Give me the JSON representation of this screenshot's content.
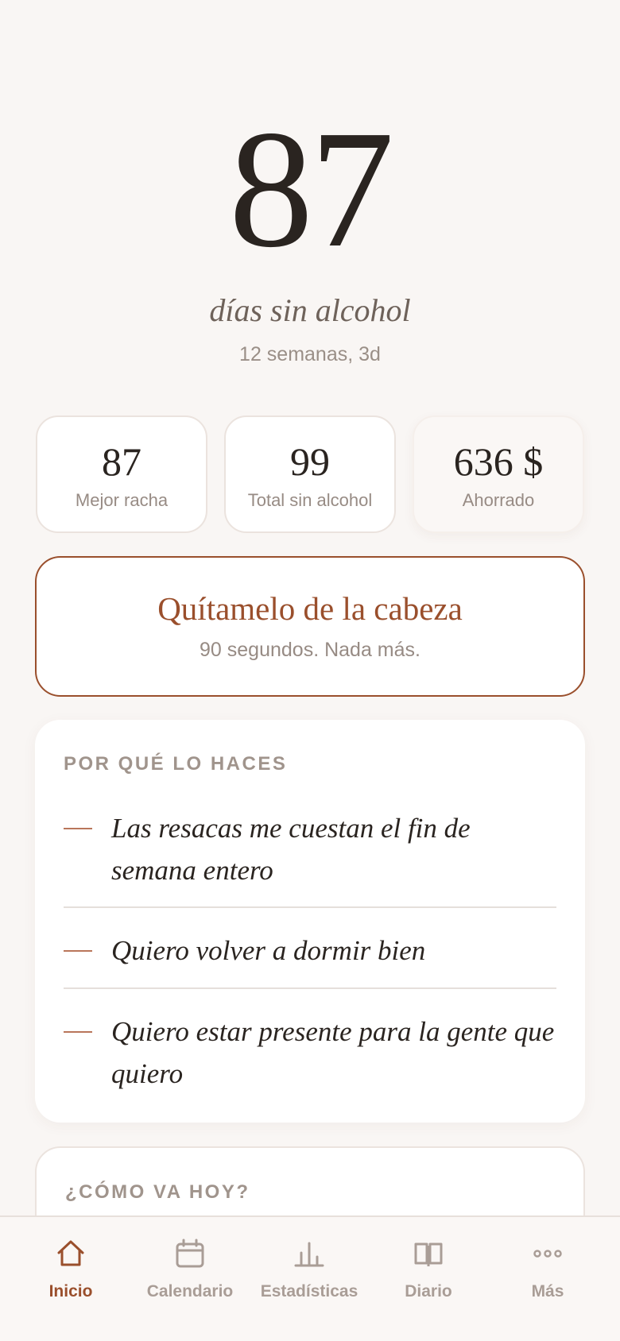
{
  "hero": {
    "count": "87",
    "label": "días sin alcohol",
    "sublabel": "12 semanas, 3d"
  },
  "stats": [
    {
      "value": "87",
      "label": "Mejor racha"
    },
    {
      "value": "99",
      "label": "Total sin alcohol"
    },
    {
      "value": "636 $",
      "label": "Ahorrado"
    }
  ],
  "clear_card": {
    "title": "Quítamelo de la cabeza",
    "subtitle": "90 segundos. Nada más."
  },
  "reasons": {
    "title": "POR QUÉ LO HACES",
    "items": [
      "Las resacas me cuestan el fin de semana entero",
      "Quiero volver a dormir bien",
      "Quiero estar presente para la gente que quiero"
    ]
  },
  "today": {
    "title": "¿CÓMO VA HOY?"
  },
  "tabbar": {
    "items": [
      {
        "label": "Inicio",
        "icon": "home-icon",
        "active": true
      },
      {
        "label": "Calendario",
        "icon": "calendar-icon",
        "active": false
      },
      {
        "label": "Estadísticas",
        "icon": "bar-chart-icon",
        "active": false
      },
      {
        "label": "Diario",
        "icon": "book-icon",
        "active": false
      },
      {
        "label": "Más",
        "icon": "more-dots-icon",
        "active": false
      }
    ]
  },
  "colors": {
    "background": "#f9f6f4",
    "accent": "#9a4f2c",
    "text": "#2a2420",
    "muted": "#978b84"
  }
}
